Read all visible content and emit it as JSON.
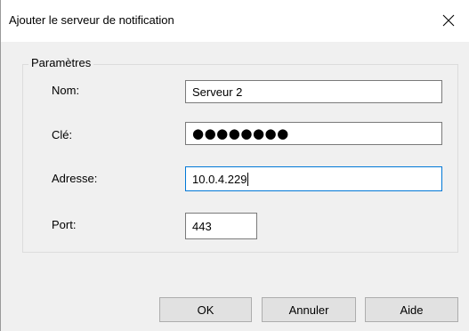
{
  "window": {
    "title": "Ajouter le serveur de notification",
    "close_icon": "close-icon"
  },
  "group": {
    "label": "Paramètres"
  },
  "fields": {
    "name": {
      "label": "Nom:",
      "value": "Serveur 2"
    },
    "key": {
      "label": "Clé:",
      "value": "●●●●●●●●"
    },
    "address": {
      "label": "Adresse:",
      "value": "10.0.4.229"
    },
    "port": {
      "label": "Port:",
      "value": "443"
    }
  },
  "buttons": {
    "ok": "OK",
    "cancel": "Annuler",
    "help": "Aide"
  },
  "colors": {
    "dialog_bg": "#f0f0f0",
    "focus_border": "#0078d7",
    "button_bg": "#e1e1e1"
  }
}
